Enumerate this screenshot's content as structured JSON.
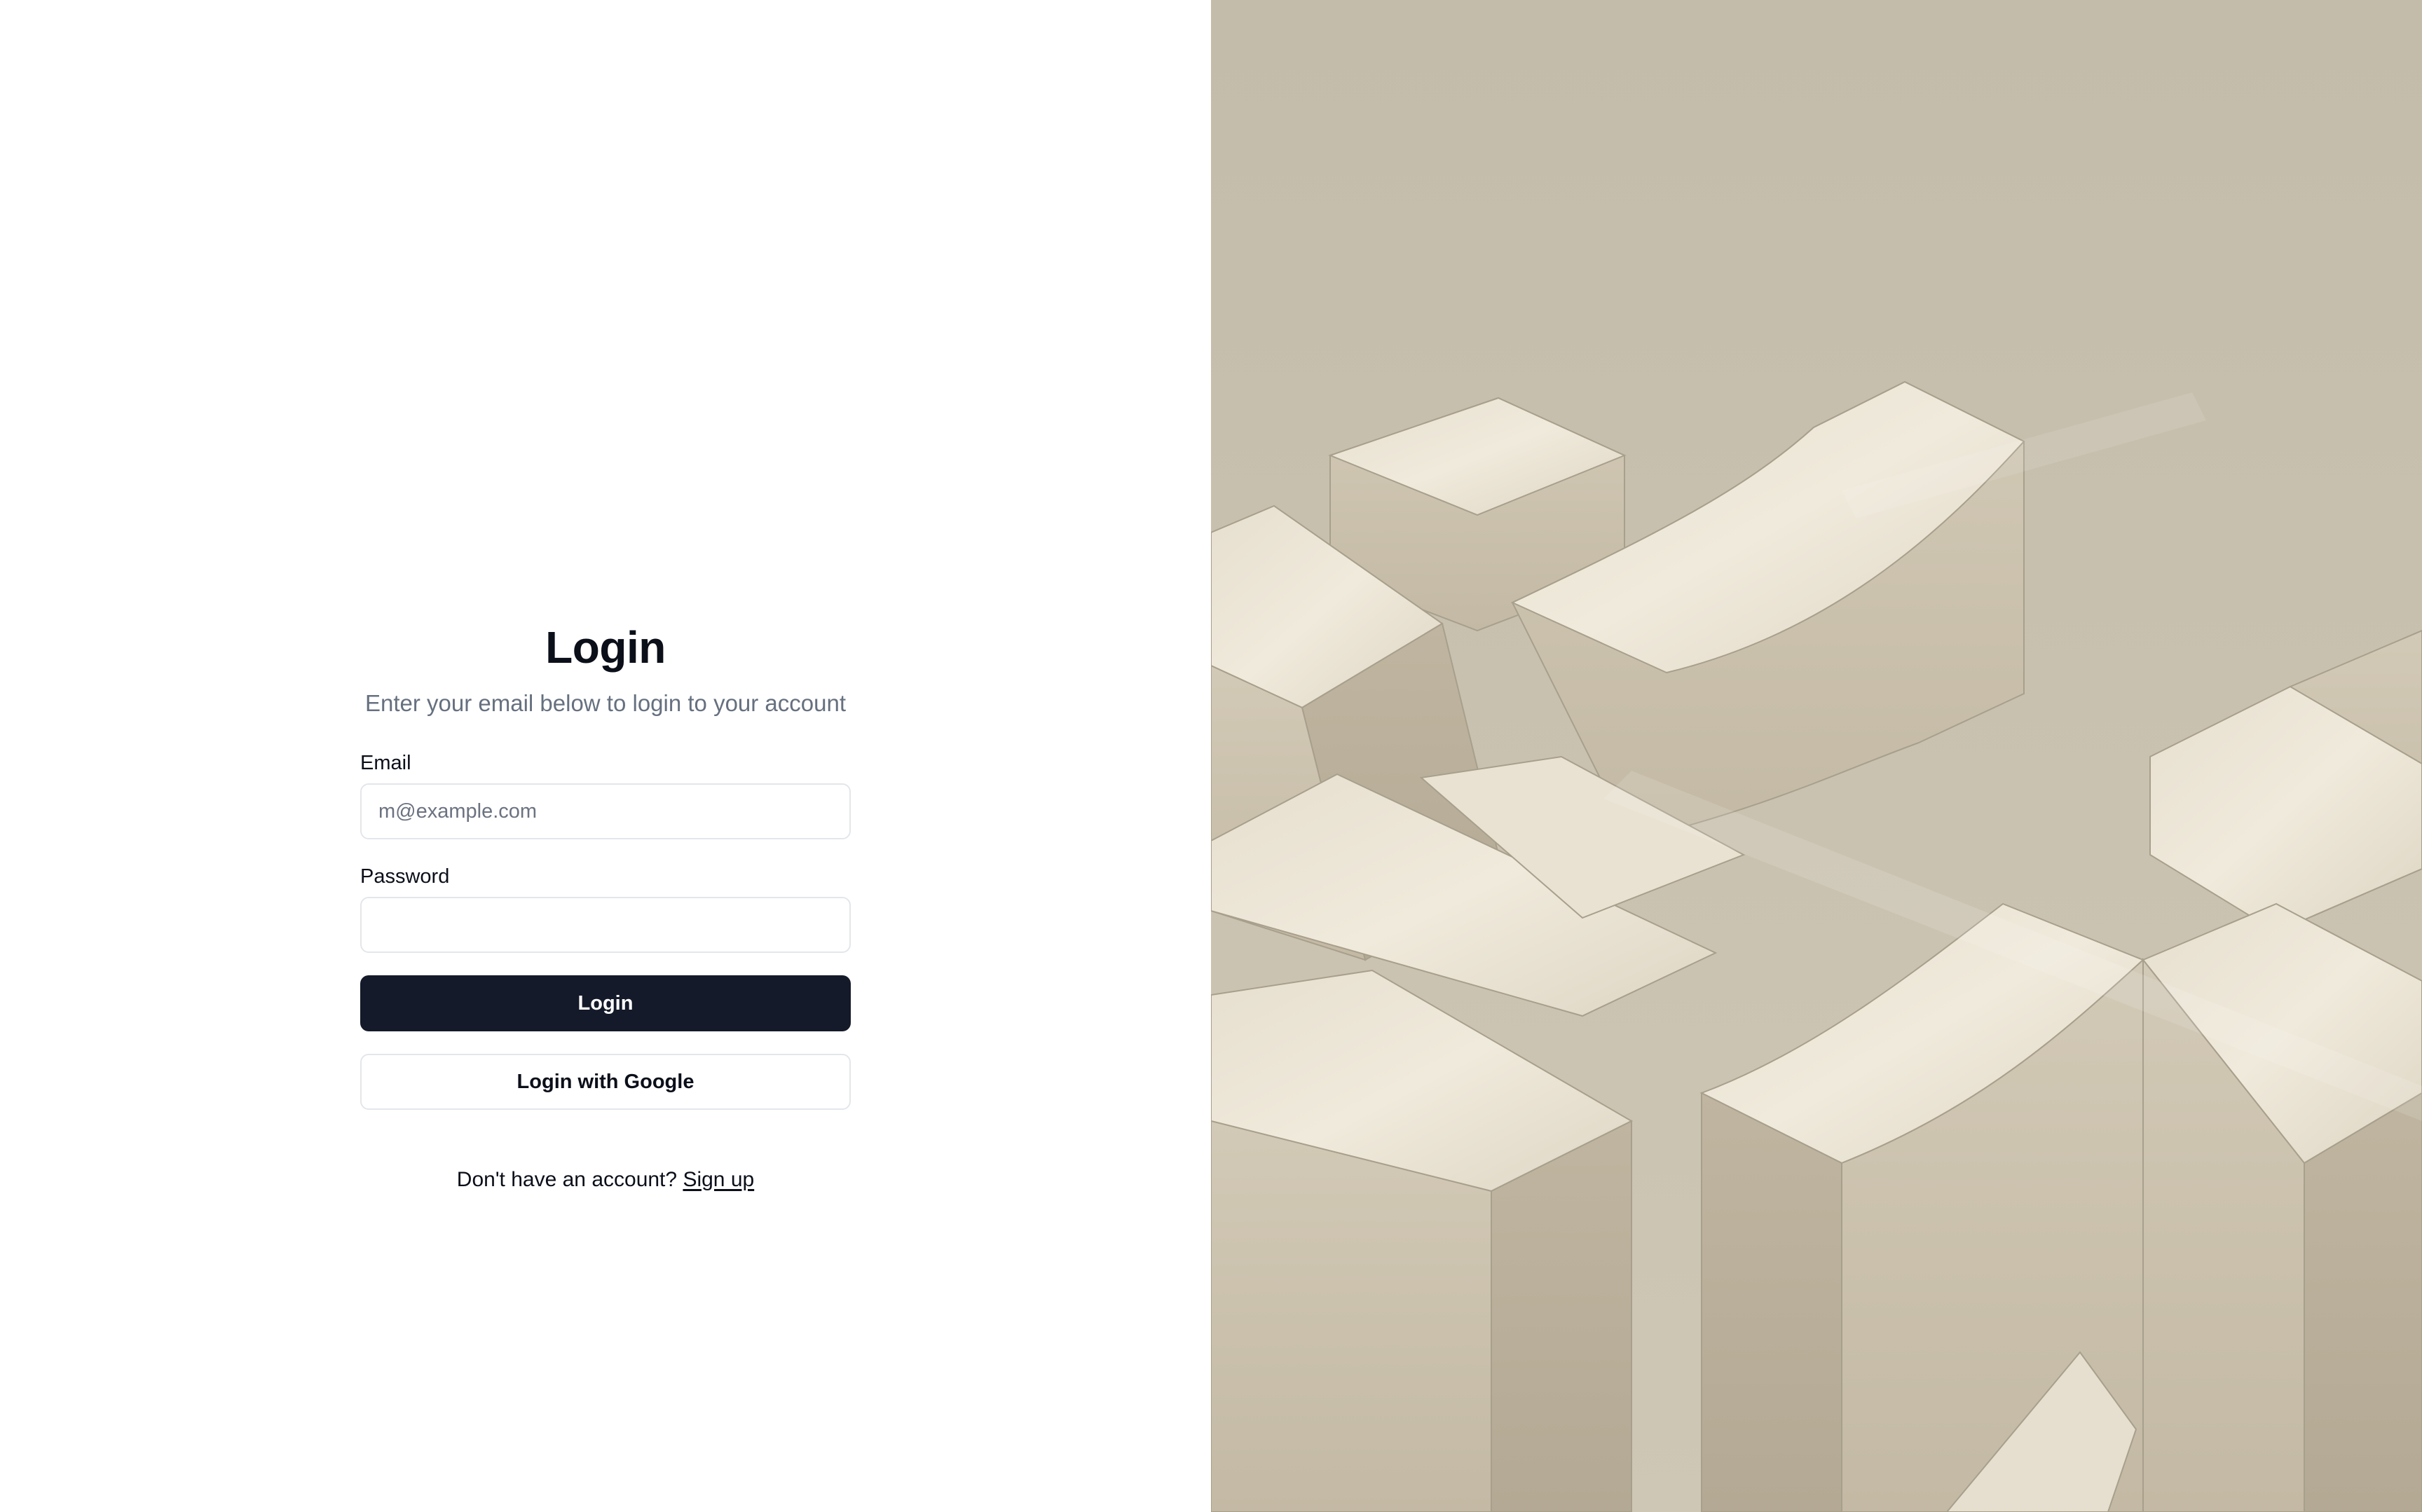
{
  "login": {
    "title": "Login",
    "subtitle": "Enter your email below to login to your account",
    "email_label": "Email",
    "email_placeholder": "m@example.com",
    "email_value": "",
    "password_label": "Password",
    "password_value": "",
    "login_button": "Login",
    "google_button": "Login with Google",
    "signup_prompt": "Don't have an account?",
    "signup_link": "Sign up"
  },
  "colors": {
    "primary_button": "#141a29",
    "text": "#0b0f19",
    "muted_text": "#66707f",
    "border": "#e3e6ea",
    "image_background": "#c6bead"
  }
}
